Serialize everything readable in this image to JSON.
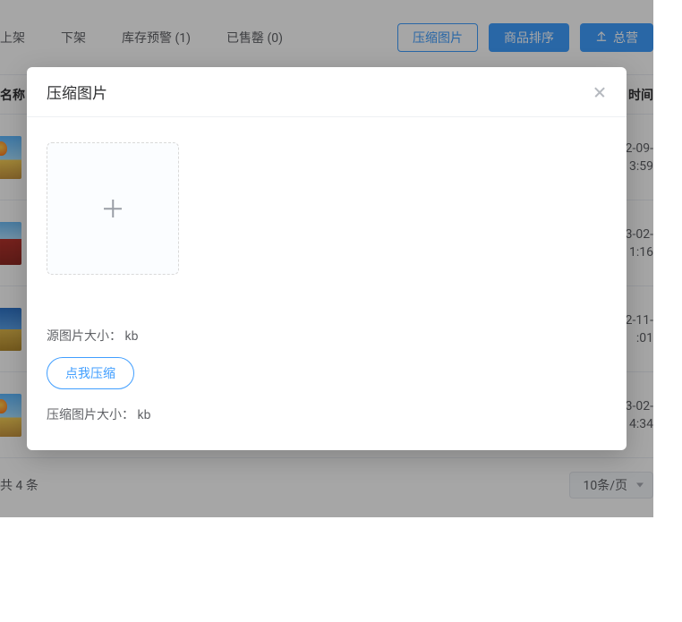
{
  "toolbar": {
    "tabs": {
      "up": "上架",
      "down": "下架",
      "lowstock": "库存预警 (1)",
      "soldout": "已售罄 (0)"
    },
    "actions": {
      "compress": "压缩图片",
      "sort": "商品排序",
      "overview": "总营"
    }
  },
  "table": {
    "headers": {
      "name": "名称",
      "time": "时间"
    },
    "rows": [
      {
        "d1": "2-09-",
        "d2": "3:59"
      },
      {
        "d1": "3-02-",
        "d2": "1:16"
      },
      {
        "d1": "2-11-",
        "d2": ":01"
      },
      {
        "d1": "3-02-",
        "d2": "4:34"
      }
    ]
  },
  "footer": {
    "total": "共 4 条",
    "pagesize": "10条/页"
  },
  "dialog": {
    "title": "压缩图片",
    "src_size_label": "源图片大小：",
    "src_size_unit": "kb",
    "compress_btn": "点我压缩",
    "out_size_label": "压缩图片大小：",
    "out_size_unit": "kb"
  }
}
